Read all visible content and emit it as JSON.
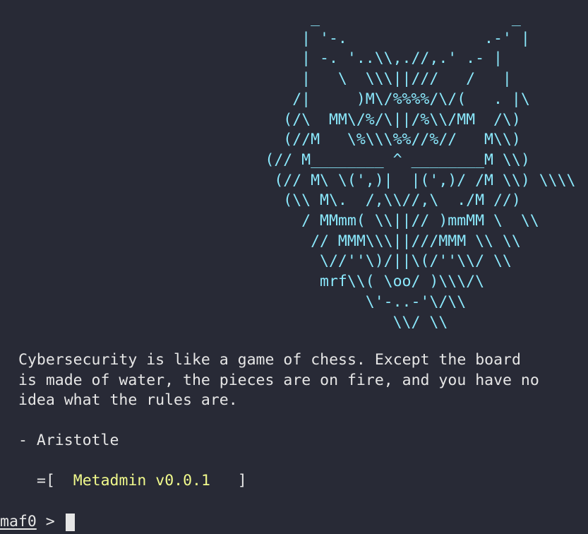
{
  "ascii_art": "                                  _                     _\n                                 | '-.               .-' |\n                                 | -. '..\\\\,.//,.' .- |\n                                 |   \\  \\\\\\||///   /   |\n                                /|     )M\\/%%%%/\\/(   . |\\\n                               (/\\  MM\\/%/\\||/%\\\\/MM  /\\)\n                               (//M   \\%\\\\\\%%//%//   M\\\\)\n                             (// M________ ^ ________M \\\\)\n                              (// M\\ \\(',)|  |(',)/ /M \\\\) \\\\\\\\\n                               (\\\\ M\\.  /,\\\\//,\\  ./M //)\n                                 / MMmm( \\\\||// )mmMM \\  \\\\\n                                  // MMM\\\\\\||///MMM \\\\ \\\\\n                                   \\//''\\)/||\\(/''\\\\/ \\\\\n                                   mrf\\\\( \\oo/ )\\\\\\/\\\n                                        \\'-..-'\\/\\\\\n                                           \\\\/ \\\\",
  "quote": "Cybersecurity is like a game of chess. Except the board\nis made of water, the pieces are on fire, and you have no\nidea what the rules are.",
  "attribution": "- Aristotle",
  "banner": {
    "open": "=[  ",
    "version": "Metadmin v0.0.1",
    "close": "   ]"
  },
  "prompt": {
    "user": "maf0",
    "symbol": " > "
  },
  "colors": {
    "background": "#282a36",
    "ascii": "#8be9fd",
    "text": "#e6e6e6",
    "version": "#f1fa8c"
  }
}
